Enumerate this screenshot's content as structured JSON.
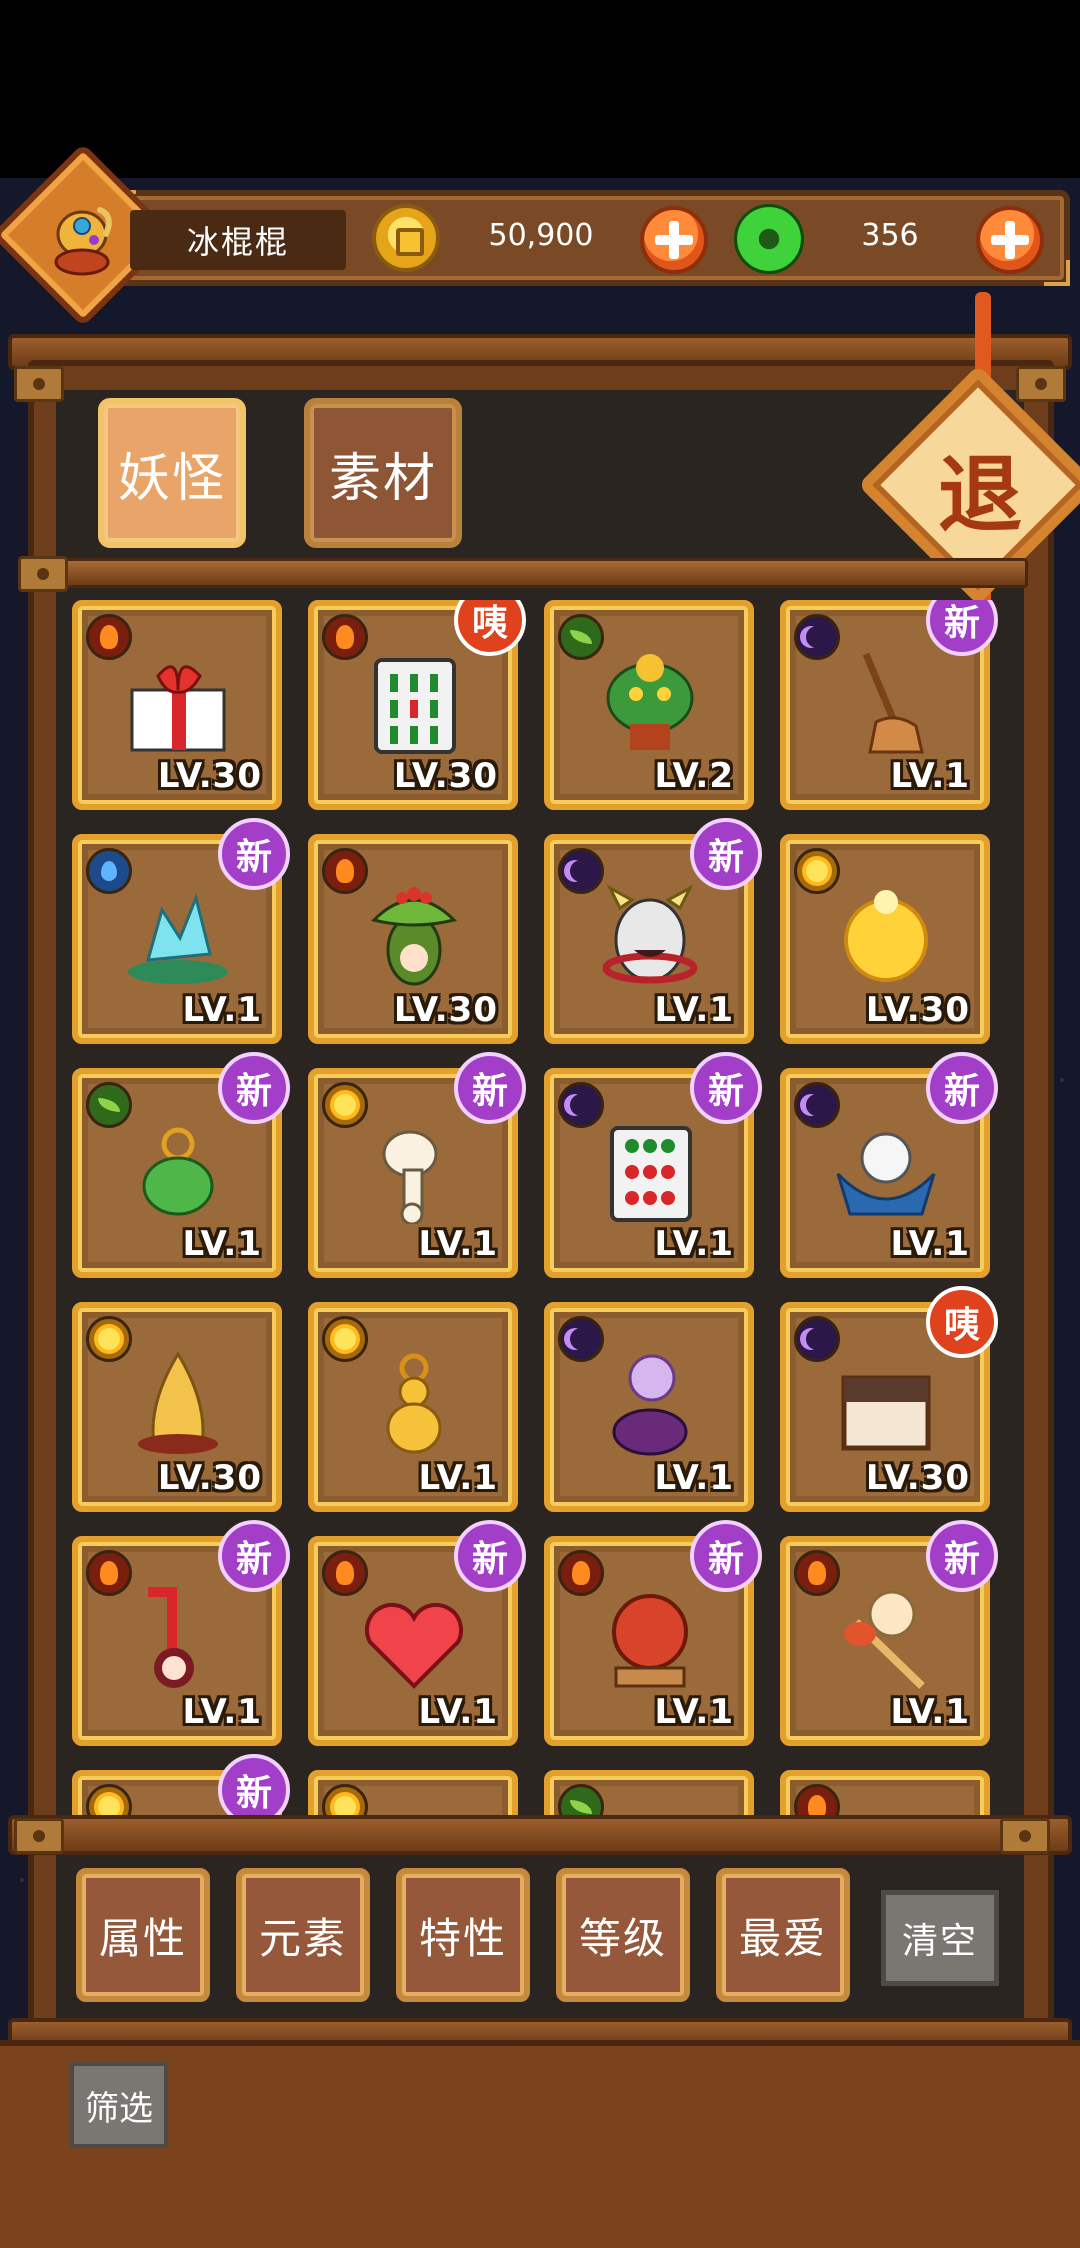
{
  "player": {
    "name": "冰棍棍"
  },
  "currency": {
    "coins": "50,900",
    "gems": "356"
  },
  "quit_label": "退",
  "tabs": [
    {
      "label": "妖怪",
      "active": true
    },
    {
      "label": "素材",
      "active": false
    }
  ],
  "items": [
    {
      "name": "gift-box",
      "element": "fire",
      "level": "LV.30",
      "badge": ""
    },
    {
      "name": "mahjong-tile-green",
      "element": "fire",
      "level": "LV.30",
      "badge": "咦"
    },
    {
      "name": "green-dragon-monster",
      "element": "leaf",
      "level": "LV.2",
      "badge": ""
    },
    {
      "name": "broom-monster",
      "element": "moon",
      "level": "LV.1",
      "badge": "新"
    },
    {
      "name": "crystal-monster",
      "element": "water",
      "level": "LV.1",
      "badge": "新"
    },
    {
      "name": "mandrake-monster",
      "element": "fire",
      "level": "LV.30",
      "badge": ""
    },
    {
      "name": "oni-mask-monster",
      "element": "moon",
      "level": "LV.1",
      "badge": "新"
    },
    {
      "name": "lantern-ghost",
      "element": "sun",
      "level": "LV.30",
      "badge": ""
    },
    {
      "name": "jade-gourd",
      "element": "leaf",
      "level": "LV.1",
      "badge": "新"
    },
    {
      "name": "bone-spirit",
      "element": "sun",
      "level": "LV.1",
      "badge": "新"
    },
    {
      "name": "mahjong-tile-red",
      "element": "moon",
      "level": "LV.1",
      "badge": "新"
    },
    {
      "name": "ghost-in-bowl",
      "element": "moon",
      "level": "LV.1",
      "badge": "新"
    },
    {
      "name": "horn-spirit",
      "element": "sun",
      "level": "LV.30",
      "badge": ""
    },
    {
      "name": "golden-gourd",
      "element": "sun",
      "level": "LV.1",
      "badge": ""
    },
    {
      "name": "smoke-pot-spirit",
      "element": "moon",
      "level": "LV.1",
      "badge": ""
    },
    {
      "name": "treasure-chest-monster",
      "element": "moon",
      "level": "LV.30",
      "badge": "咦"
    },
    {
      "name": "umbrella-ghost",
      "element": "fire",
      "level": "LV.1",
      "badge": "新"
    },
    {
      "name": "heart-monster",
      "element": "fire",
      "level": "LV.1",
      "badge": "新"
    },
    {
      "name": "red-ball-spirit",
      "element": "fire",
      "level": "LV.1",
      "badge": "新"
    },
    {
      "name": "match-spirit",
      "element": "fire",
      "level": "LV.1",
      "badge": "新"
    },
    {
      "name": "partial-item",
      "element": "sun",
      "level": "",
      "badge": "新"
    },
    {
      "name": "partial-item",
      "element": "sun",
      "level": "",
      "badge": ""
    },
    {
      "name": "partial-item",
      "element": "leaf",
      "level": "",
      "badge": ""
    },
    {
      "name": "partial-item",
      "element": "fire",
      "level": "",
      "badge": ""
    }
  ],
  "filters": [
    "属性",
    "元素",
    "特性",
    "等级",
    "最爱"
  ],
  "clear_label": "清空",
  "screen_label": "筛选",
  "colors": {
    "card_border": "#e3a02c",
    "new_badge": "#a23ec8",
    "hey_badge": "#e0421e"
  }
}
